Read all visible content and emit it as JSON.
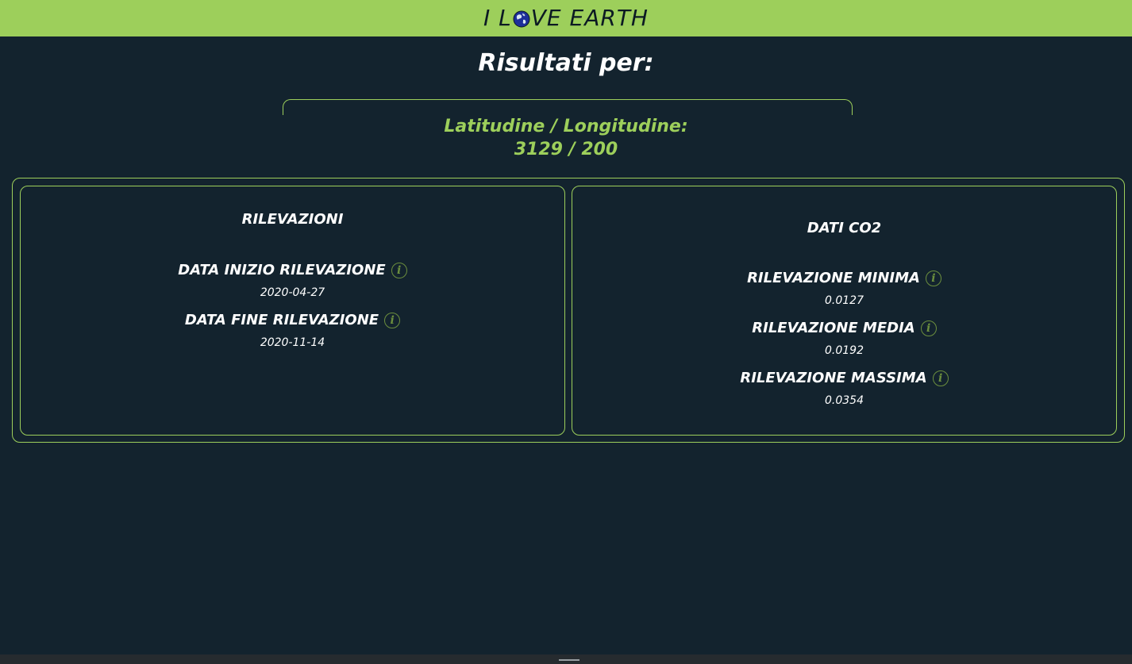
{
  "header": {
    "brand_before": "I L",
    "brand_after": "VE EARTH",
    "brand_icon": "globe-icon"
  },
  "page": {
    "title": "Risultati per:",
    "coords_label": "Latitudine / Longitudine:",
    "coords_value": "3129 / 200"
  },
  "rilevazioni": {
    "title": "RILEVAZIONI",
    "fields": [
      {
        "label": "DATA INIZIO RILEVAZIONE",
        "value": "2020-04-27",
        "icon": "info-icon"
      },
      {
        "label": "DATA FINE RILEVAZIONE",
        "value": "2020-11-14",
        "icon": "info-icon"
      }
    ]
  },
  "co2": {
    "title": "DATI CO2",
    "fields": [
      {
        "label": "RILEVAZIONE MINIMA",
        "value": "0.0127",
        "icon": "info-icon"
      },
      {
        "label": "RILEVAZIONE MEDIA",
        "value": "0.0192",
        "icon": "info-icon"
      },
      {
        "label": "RILEVAZIONE MASSIMA",
        "value": "0.0354",
        "icon": "info-icon"
      }
    ]
  },
  "colors": {
    "accent": "#9dcf5b",
    "background": "#13232e",
    "text": "#ffffff",
    "icon": "#6c8f3e"
  }
}
